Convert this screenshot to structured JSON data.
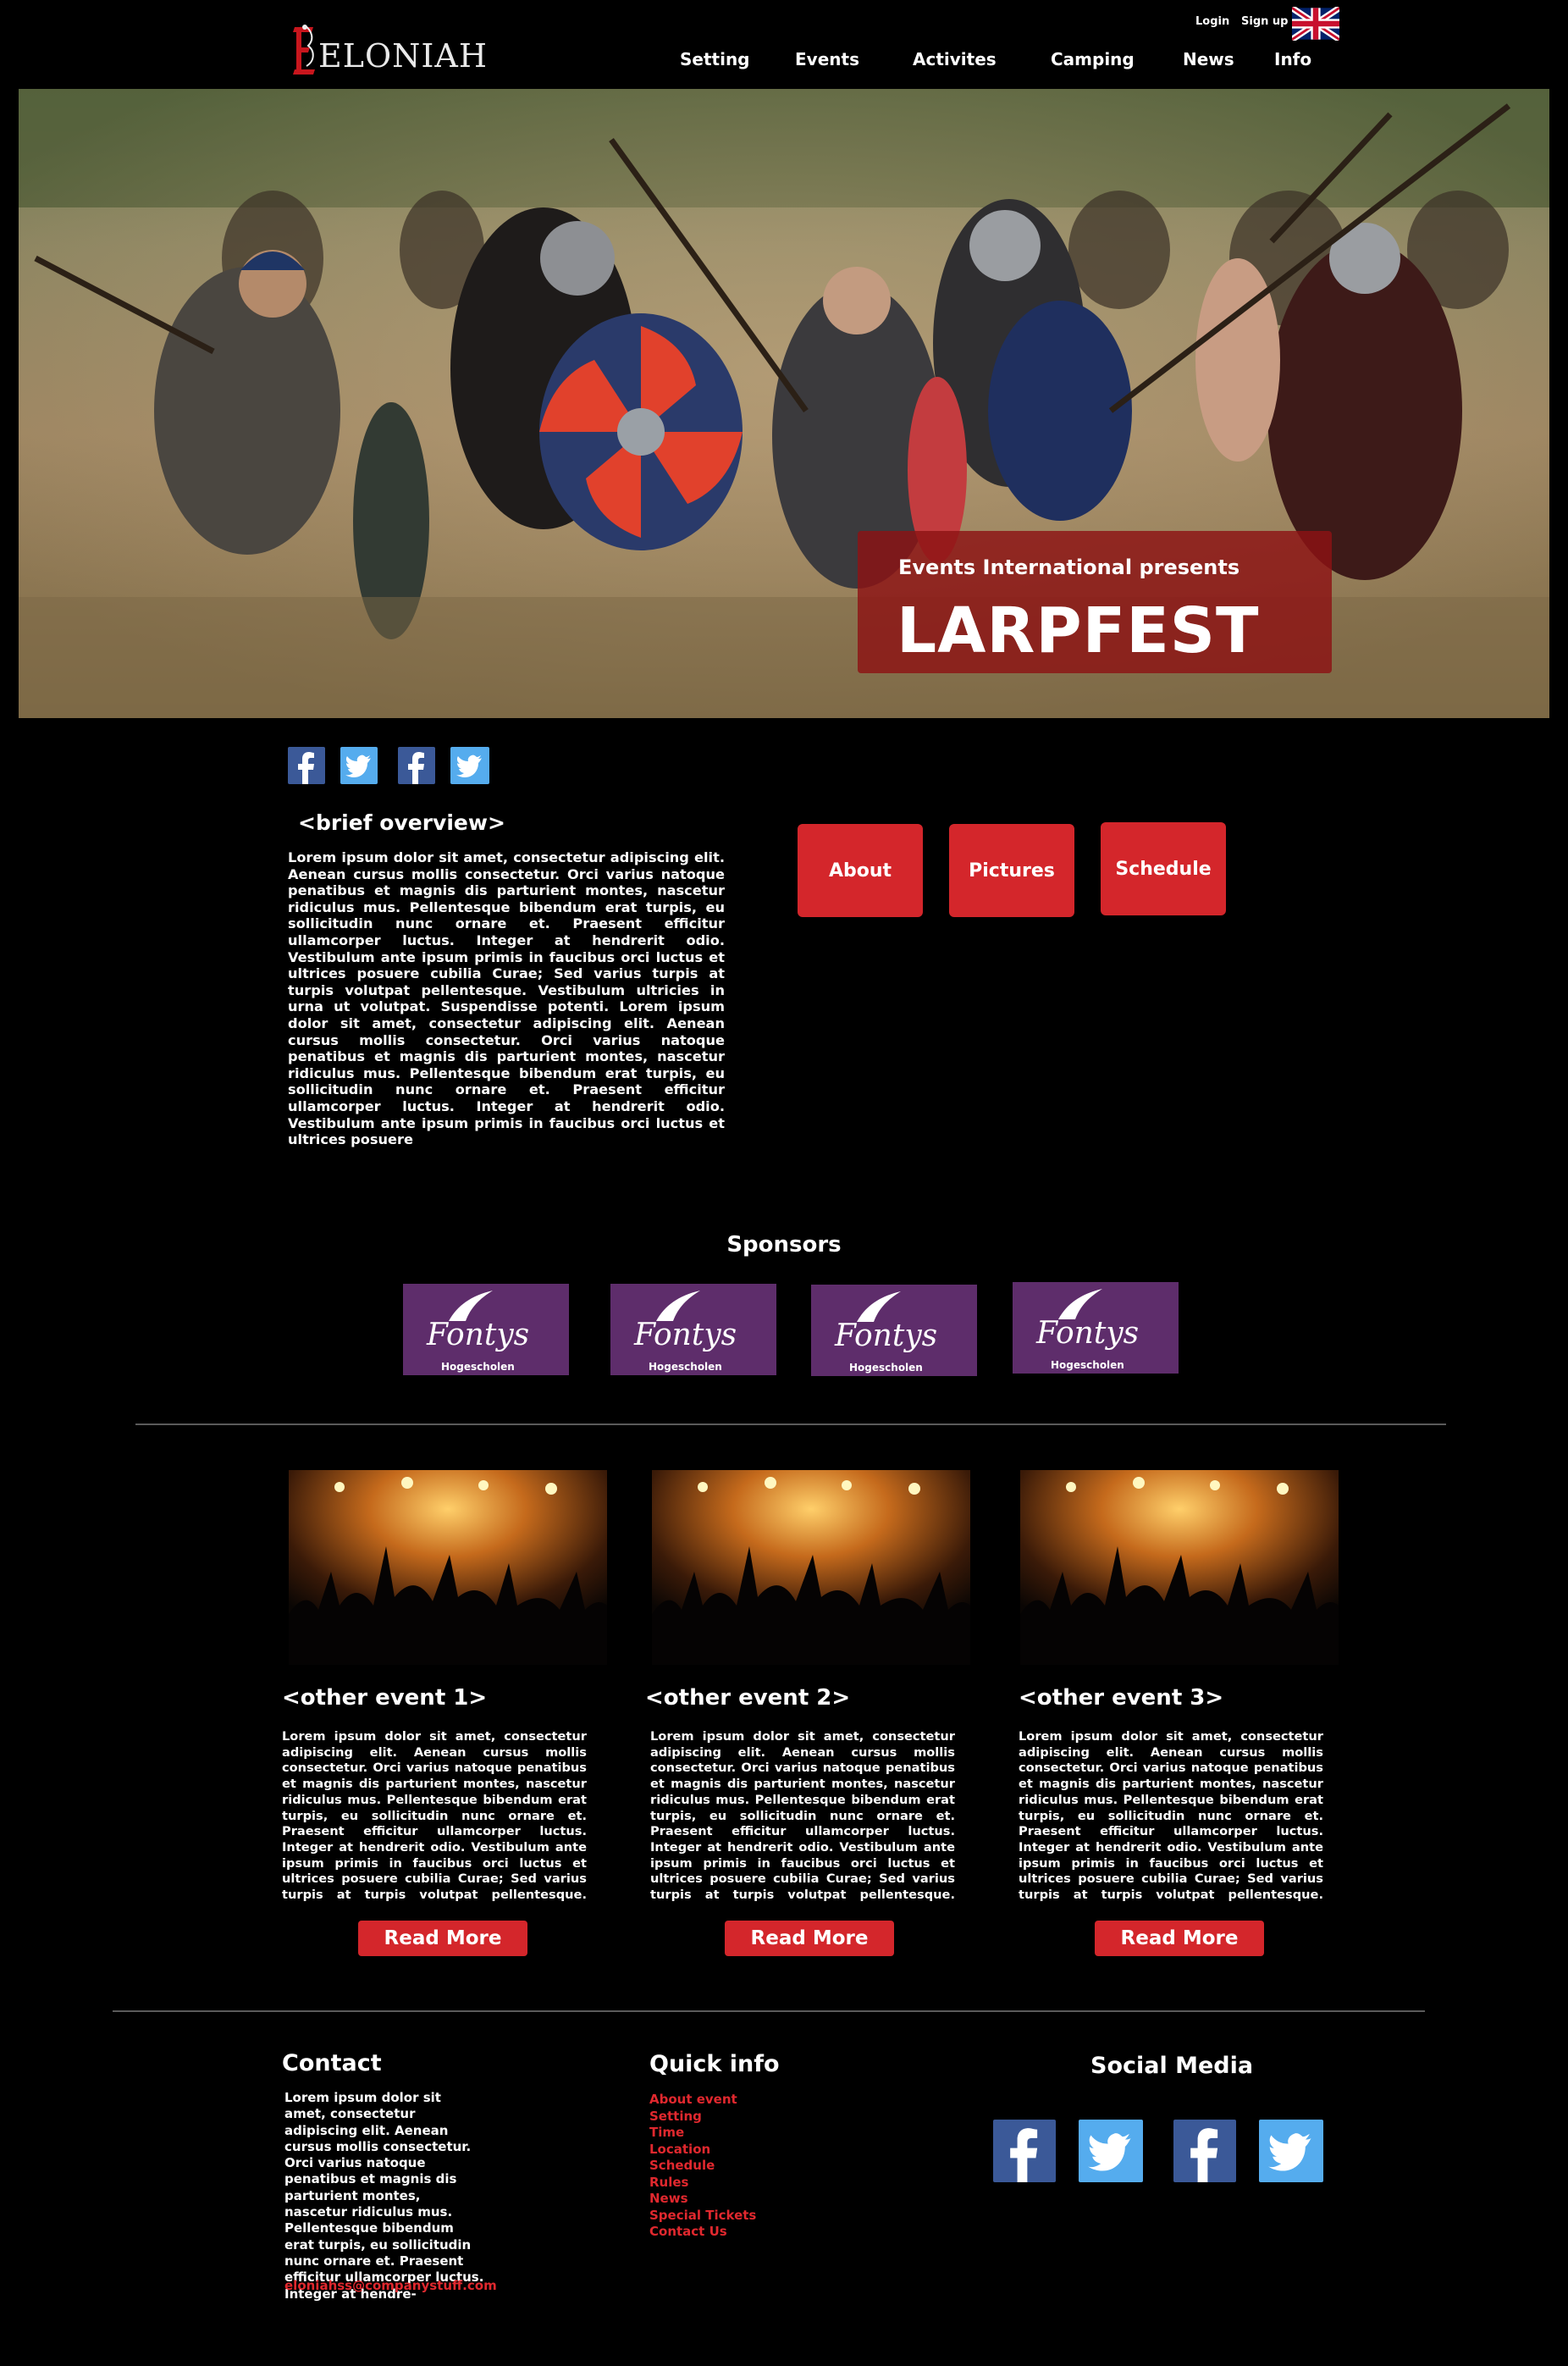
{
  "header": {
    "logo_text": "ELONIAH",
    "login": "Login",
    "signup": "Sign up",
    "nav": [
      "Setting",
      "Events",
      "Activites",
      "Camping",
      "News",
      "Info"
    ],
    "language_flag": "uk-flag-icon"
  },
  "hero": {
    "presents": "Events International presents",
    "title": "LARPFEST"
  },
  "overview": {
    "heading": "<brief overview>",
    "text": "Lorem ipsum dolor sit amet, consectetur adipiscing elit. Aenean cursus mollis consectetur. Orci varius natoque penatibus et magnis dis parturient montes, nascetur ridiculus mus. Pellentesque bibendum erat turpis, eu sollicitudin nunc ornare et. Praesent efficitur ullamcorper luctus. Integer at hendrerit odio. Vestibulum ante ipsum primis in faucibus orci luctus et ultrices posuere cubilia Curae; Sed varius turpis at turpis volutpat pellentesque. Vestibulum ultricies in urna ut volutpat. Suspendisse potenti. Lorem ipsum dolor sit amet, consectetur adipiscing elit. Aenean cursus mollis consectetur. Orci varius natoque penatibus et magnis dis parturient montes, nascetur ridiculus mus. Pellentesque bibendum erat turpis, eu sollicitudin nunc ornare et. Praesent efficitur ullamcorper luctus. Integer at hendrerit odio. Vestibulum ante ipsum primis in faucibus orci luctus et ultrices posuere",
    "buttons": [
      "About",
      "Pictures",
      "Schedule"
    ]
  },
  "sponsors": {
    "heading": "Sponsors",
    "brand": "Fontys",
    "sub": "Hogescholen"
  },
  "events": [
    {
      "title": "<other event 1>",
      "text": "Lorem ipsum dolor sit amet, consectetur adipiscing elit. Aenean cursus mollis consectetur. Orci varius natoque penatibus et magnis dis parturient montes, nascetur ridiculus mus. Pellentesque bibendum erat turpis, eu sollicitudin nunc ornare et. Praesent efficitur ullamcorper luctus. Integer at hendrerit odio. Vestibulum ante ipsum primis in faucibus orci luctus et ultrices posuere cubilia Curae; Sed varius turpis at turpis volutpat pellentesque. Vestibulum ultricies in urna ut",
      "button": "Read More"
    },
    {
      "title": "<other event 2>",
      "text": "Lorem ipsum dolor sit amet, consectetur adipiscing elit. Aenean cursus mollis consectetur. Orci varius natoque penatibus et magnis dis parturient montes, nascetur ridiculus mus. Pellentesque bibendum erat turpis, eu sollicitudin nunc ornare et. Praesent efficitur ullamcorper luctus. Integer at hendrerit odio. Vestibulum ante ipsum primis in faucibus orci luctus et ultrices posuere cubilia Curae; Sed varius turpis at turpis volutpat pellentesque. Vestibulum ultricies in urna ut",
      "button": "Read More"
    },
    {
      "title": "<other event 3>",
      "text": "Lorem ipsum dolor sit amet, consectetur adipiscing elit. Aenean cursus mollis consectetur. Orci varius natoque penatibus et magnis dis parturient montes, nascetur ridiculus mus. Pellentesque bibendum erat turpis, eu sollicitudin nunc ornare et. Praesent efficitur ullamcorper luctus. Integer at hendrerit odio. Vestibulum ante ipsum primis in faucibus orci luctus et ultrices posuere cubilia Curae; Sed varius turpis at turpis volutpat pellentesque. Vestibulum ultricies in urna ut",
      "button": "Read More"
    }
  ],
  "footer": {
    "contact_heading": "Contact",
    "contact_text": "Lorem ipsum dolor sit amet, consectetur adipiscing elit. Aenean cursus mollis consectetur. Orci varius natoque penatibus et magnis dis parturient montes, nascetur ridiculus mus. Pellentesque bibendum erat turpis, eu sollicitudin nunc ornare et. Praesent efficitur ullamcorper luctus. Integer at hendre-",
    "email": "eloniahss@companystuff.com",
    "quick_heading": "Quick info",
    "quick_links": [
      "About event",
      "Setting",
      "Time",
      "Location",
      "Schedule",
      "Rules",
      "News",
      "Special Tickets",
      "Contact Us"
    ],
    "social_heading": "Social Media"
  },
  "colors": {
    "accent_red": "#d4262b",
    "link_red": "#e0282e",
    "sponsor_purple": "#5e2d6b",
    "facebook": "#3b5998",
    "twitter": "#55acee"
  }
}
